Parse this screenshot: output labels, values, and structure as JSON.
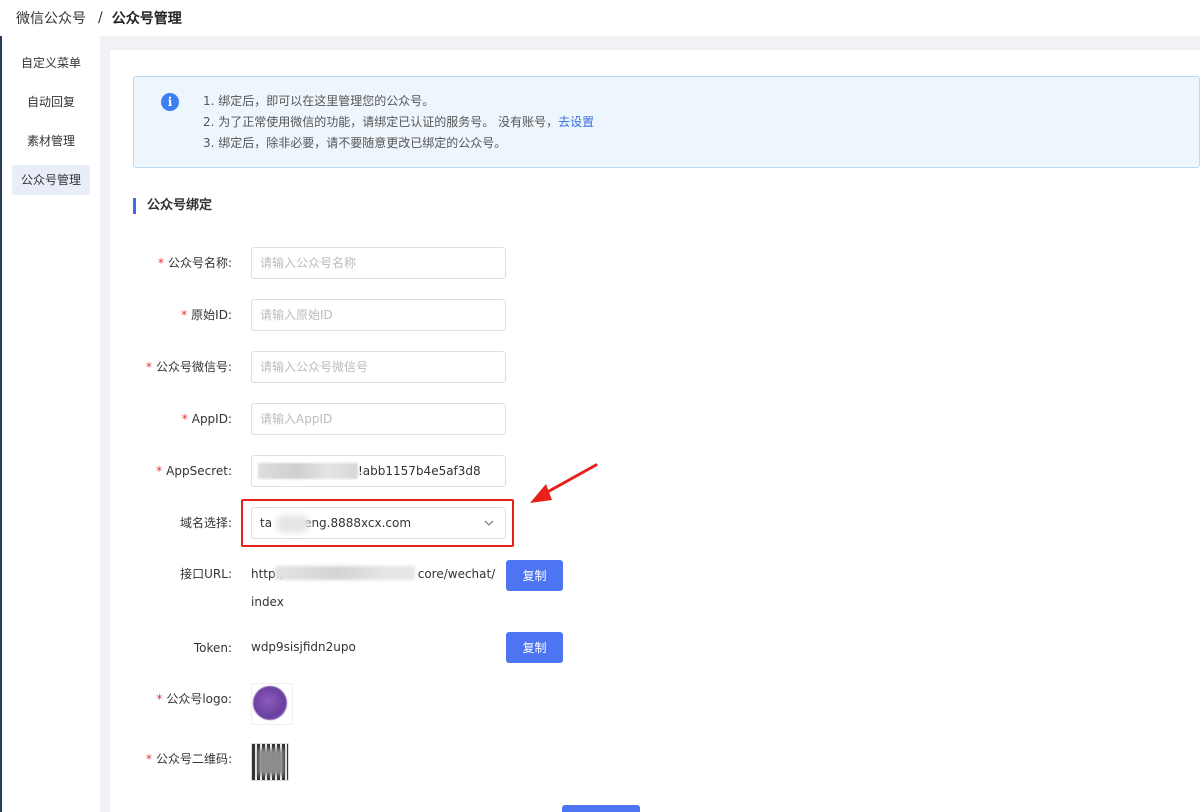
{
  "breadcrumb": {
    "parent": "微信公众号",
    "separator": "/",
    "current": "公众号管理"
  },
  "sidebar": {
    "items": [
      {
        "label": "自定义菜单",
        "active": false
      },
      {
        "label": "自动回复",
        "active": false
      },
      {
        "label": "素材管理",
        "active": false
      },
      {
        "label": "公众号管理",
        "active": true
      }
    ]
  },
  "notice": {
    "icon": "info-icon",
    "line1": "1. 绑定后，即可以在这里管理您的公众号。",
    "line2": "2. 为了正常使用微信的功能，请绑定已认证的服务号。 没有账号，",
    "line2_link": "去设置",
    "line3": "3. 绑定后，除非必要，请不要随意更改已绑定的公众号。"
  },
  "section": {
    "title": "公众号绑定"
  },
  "form": {
    "required_mark": "*",
    "name": {
      "label": "公众号名称:",
      "placeholder": "请输入公众号名称",
      "value": ""
    },
    "original_id": {
      "label": "原始ID:",
      "placeholder": "请输入原始ID",
      "value": ""
    },
    "wechat_id": {
      "label": "公众号微信号:",
      "placeholder": "请输入公众号微信号",
      "value": ""
    },
    "appid": {
      "label": "AppID:",
      "placeholder": "请输入AppID",
      "value": ""
    },
    "appsecret": {
      "label": "AppSecret:",
      "value": "!abb1157b4e5af3d8"
    },
    "domain": {
      "label": "域名选择:",
      "prefix": "ta",
      "suffix": "eng.8888xcx.com"
    },
    "url": {
      "label": "接口URL:",
      "prefix": "http:/",
      "suffix": "core/wechat/index",
      "copy_label": "复制"
    },
    "token": {
      "label": "Token:",
      "value": "wdp9sisjfidn2upo",
      "copy_label": "复制"
    },
    "logo": {
      "label": "公众号logo:"
    },
    "qrcode": {
      "label": "公众号二维码:"
    }
  },
  "colors": {
    "accent": "#4d74f2",
    "highlight": "#e8201b",
    "required": "#e33333"
  }
}
